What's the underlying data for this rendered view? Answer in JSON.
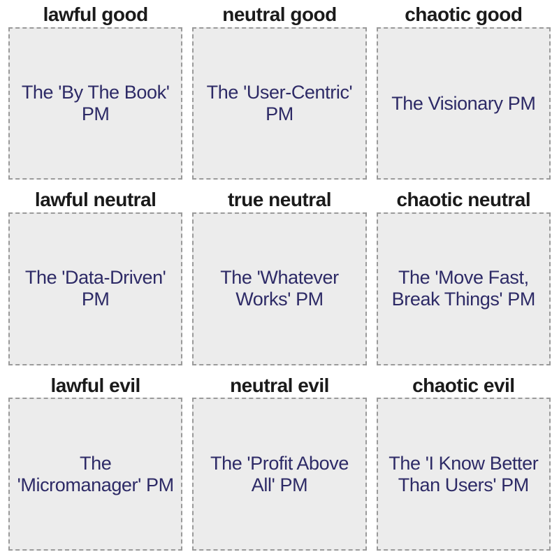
{
  "cells": [
    {
      "alignment": "lawful good",
      "content": "The 'By The Book' PM"
    },
    {
      "alignment": "neutral good",
      "content": "The 'User-Centric' PM"
    },
    {
      "alignment": "chaotic good",
      "content": "The Visionary PM"
    },
    {
      "alignment": "lawful neutral",
      "content": "The 'Data-Driven' PM"
    },
    {
      "alignment": "true neutral",
      "content": "The 'Whatever Works' PM"
    },
    {
      "alignment": "chaotic neutral",
      "content": "The 'Move Fast, Break Things' PM"
    },
    {
      "alignment": "lawful evil",
      "content": "The 'Micromanager' PM"
    },
    {
      "alignment": "neutral evil",
      "content": "The 'Profit Above All' PM"
    },
    {
      "alignment": "chaotic evil",
      "content": "The 'I Know Better Than Users' PM"
    }
  ]
}
